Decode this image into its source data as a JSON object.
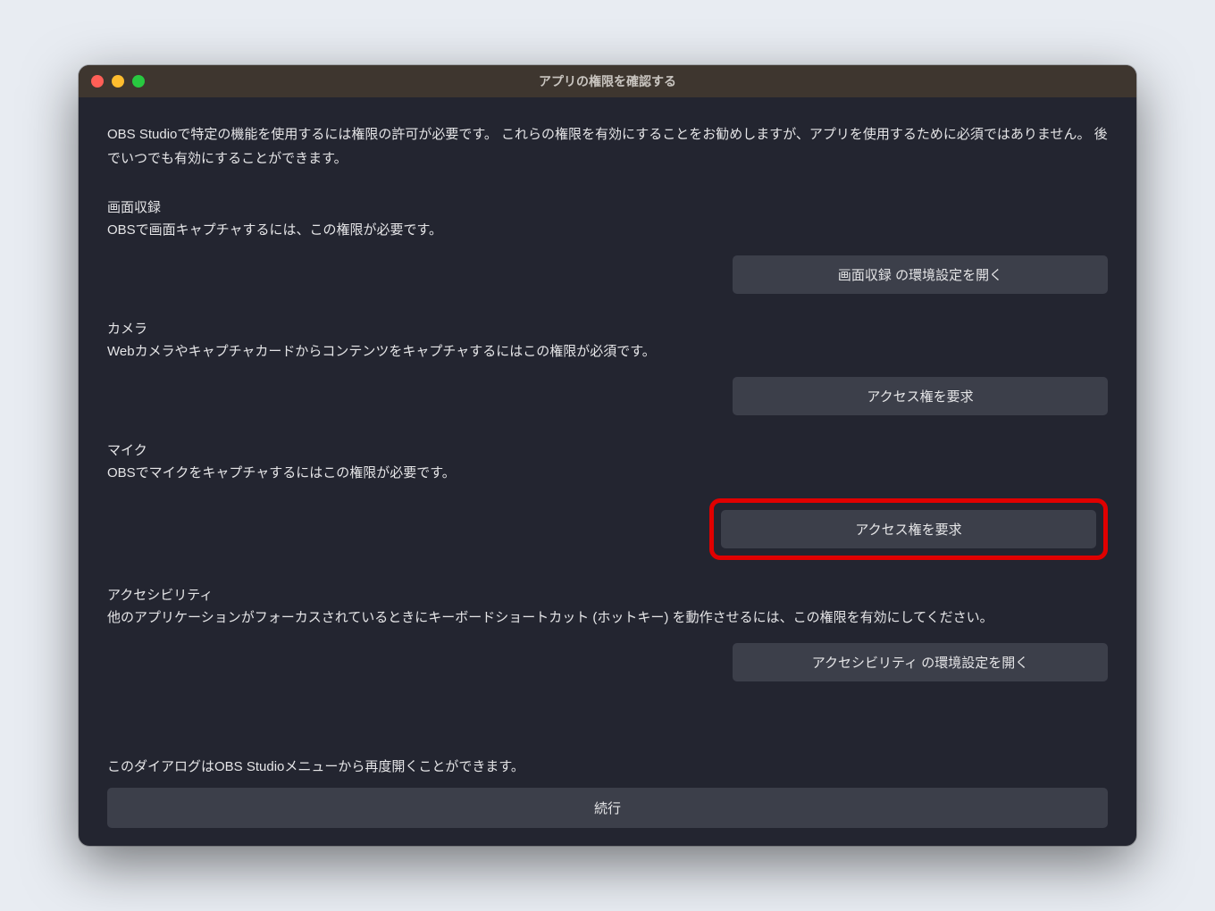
{
  "window": {
    "title": "アプリの権限を確認する"
  },
  "intro": "OBS Studioで特定の機能を使用するには権限の許可が必要です。 これらの権限を有効にすることをお勧めしますが、アプリを使用するために必須ではありません。 後でいつでも有効にすることができます。",
  "sections": {
    "screen_recording": {
      "title": "画面収録",
      "desc": "OBSで画面キャプチャするには、この権限が必要です。",
      "button": "画面収録 の環境設定を開く"
    },
    "camera": {
      "title": "カメラ",
      "desc": "Webカメラやキャプチャカードからコンテンツをキャプチャするにはこの権限が必須です。",
      "button": "アクセス権を要求"
    },
    "microphone": {
      "title": "マイク",
      "desc": "OBSでマイクをキャプチャするにはこの権限が必要です。",
      "button": "アクセス権を要求"
    },
    "accessibility": {
      "title": "アクセシビリティ",
      "desc": "他のアプリケーションがフォーカスされているときにキーボードショートカット (ホットキー) を動作させるには、この権限を有効にしてください。",
      "button": "アクセシビリティ の環境設定を開く"
    }
  },
  "footer_note": "このダイアログはOBS Studioメニューから再度開くことができます。",
  "continue_label": "続行"
}
